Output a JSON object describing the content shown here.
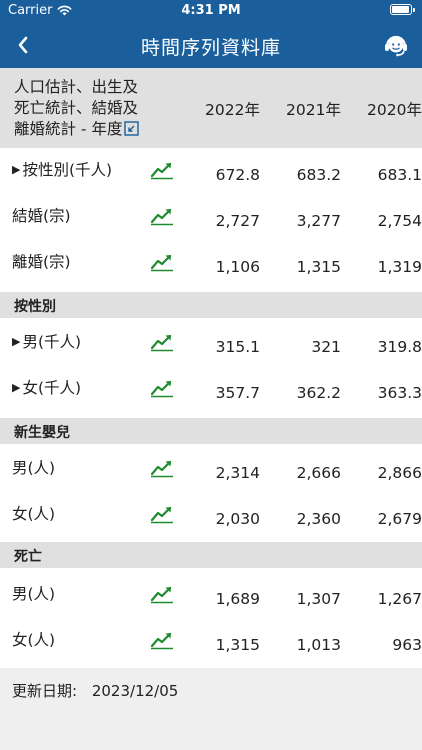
{
  "status_bar": {
    "carrier": "Carrier",
    "time": "4:31 PM"
  },
  "nav": {
    "title": "時間序列資料庫",
    "back_icon": "chevron-left-icon",
    "help_icon": "headset-icon"
  },
  "table": {
    "title_lines": [
      "人口估計、出生及",
      "死亡統計、結婚及",
      "離婚統計 - 年度"
    ],
    "years": [
      "2022年",
      "2021年",
      "2020年"
    ]
  },
  "rows": [
    {
      "label": "按性別(千人)",
      "expand": true,
      "values": [
        "672.8",
        "683.2",
        "683.1"
      ]
    },
    {
      "label": "結婚(宗)",
      "expand": false,
      "values": [
        "2,727",
        "3,277",
        "2,754"
      ]
    },
    {
      "label": "離婚(宗)",
      "expand": false,
      "values": [
        "1,106",
        "1,315",
        "1,319"
      ]
    }
  ],
  "sections": [
    {
      "label": "按性別",
      "rows": [
        {
          "label": "男(千人)",
          "expand": true,
          "values": [
            "315.1",
            "321",
            "319.8"
          ]
        },
        {
          "label": "女(千人)",
          "expand": true,
          "values": [
            "357.7",
            "362.2",
            "363.3"
          ]
        }
      ]
    },
    {
      "label": "新生嬰兒",
      "rows": [
        {
          "label": "男(人)",
          "expand": false,
          "values": [
            "2,314",
            "2,666",
            "2,866"
          ]
        },
        {
          "label": "女(人)",
          "expand": false,
          "values": [
            "2,030",
            "2,360",
            "2,679"
          ]
        }
      ]
    },
    {
      "label": "死亡",
      "rows": [
        {
          "label": "男(人)",
          "expand": false,
          "values": [
            "1,689",
            "1,307",
            "1,267"
          ]
        },
        {
          "label": "女(人)",
          "expand": false,
          "values": [
            "1,315",
            "1,013",
            "963"
          ]
        }
      ]
    }
  ],
  "footer": {
    "label": "更新日期:",
    "date": "2023/12/05"
  },
  "colors": {
    "nav_bg": "#1a5f9c",
    "header_bg": "#e0e0e0",
    "trend_green": "#1e8c2e",
    "footer_bg": "#efefef"
  }
}
